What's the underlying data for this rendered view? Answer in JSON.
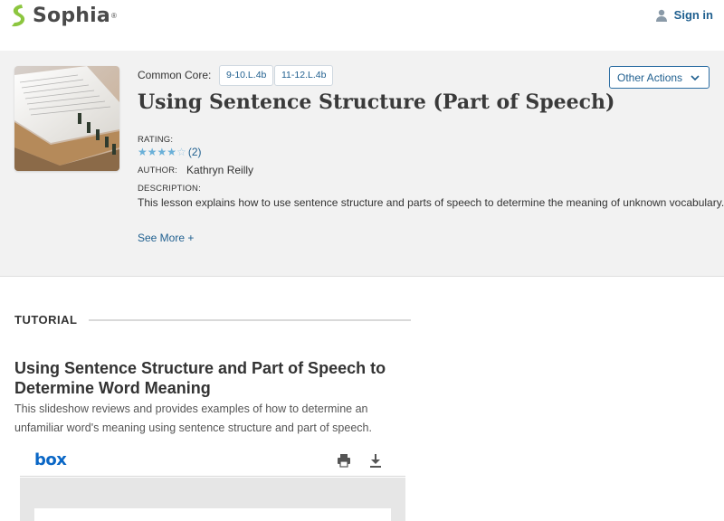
{
  "brand": {
    "name": "Sophia",
    "mark": "®"
  },
  "header": {
    "sign_in": "Sign in"
  },
  "resource": {
    "common_core_label": "Common Core:",
    "tags": [
      "9-10.L.4b",
      "11-12.L.4b"
    ],
    "title": "Using Sentence Structure (Part of Speech)",
    "other_actions": "Other Actions",
    "rating_label": "RATING:",
    "rating_stars": 4,
    "rating_max": 5,
    "rating_count": "(2)",
    "author_label": "AUTHOR:",
    "author": "Kathryn Reilly",
    "description_label": "DESCRIPTION:",
    "description": "This lesson explains how to use sentence structure and parts of speech to determine the meaning of unknown vocabulary.",
    "see_more": "See More +"
  },
  "tutorial": {
    "section_label": "TUTORIAL",
    "title": "Using Sentence Structure and Part of Speech to Determine Word Meaning",
    "description": "This slideshow reviews and provides examples of how to determine an unfamiliar word's meaning using sentence structure and part of speech."
  },
  "viewer": {
    "logo": "box"
  },
  "icons": {
    "logo": "sophia-logo-icon",
    "user": "user-icon",
    "chevron": "chevron-down-icon",
    "print": "print-icon",
    "download": "download-icon"
  },
  "colors": {
    "link": "#1f5f8f",
    "brand_green": "#8cc63f",
    "box_blue": "#0a67c6",
    "star": "#6ab0d8"
  }
}
